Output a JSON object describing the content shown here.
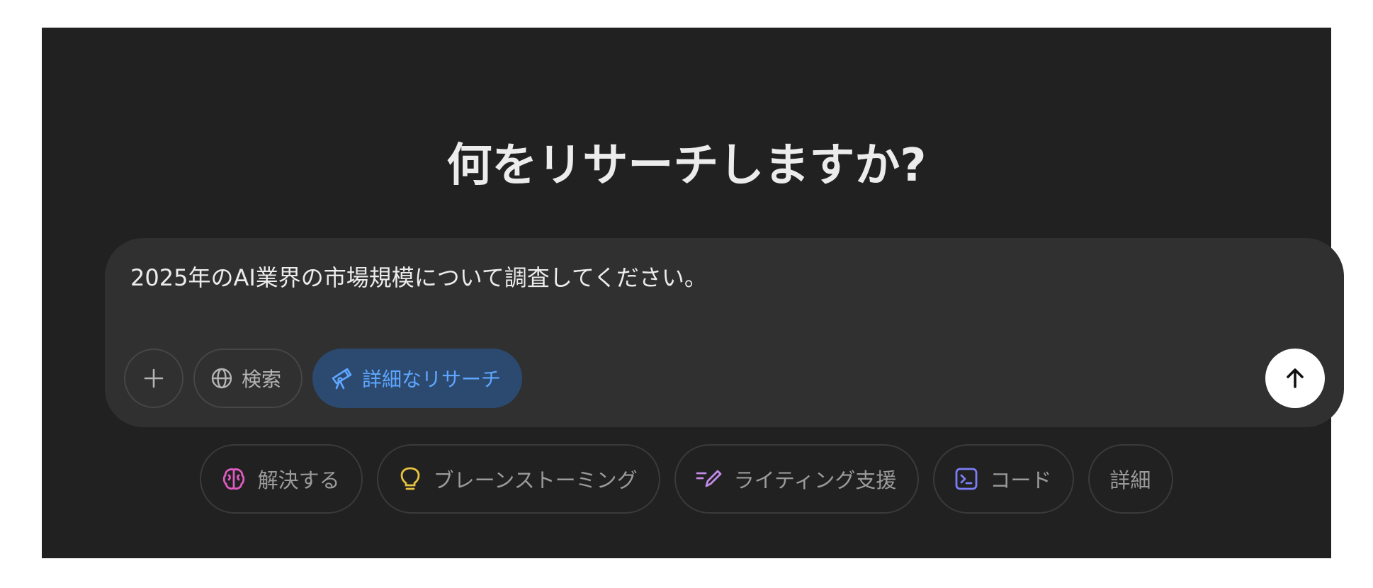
{
  "heading": "何をリサーチしますか?",
  "composer": {
    "prompt_text": "2025年のAI業界の市場規模について調査してください。",
    "tools": {
      "add_icon": "plus-icon",
      "search": {
        "label": "検索",
        "icon": "globe-icon"
      },
      "deep_research": {
        "label": "詳細なリサーチ",
        "icon": "telescope-icon",
        "active": true,
        "color": "#5ea6ff"
      }
    },
    "send_icon": "arrow-up-icon"
  },
  "suggestions": [
    {
      "label": "解決する",
      "icon": "brain-icon",
      "color": "#e05bc0"
    },
    {
      "label": "ブレーンストーミング",
      "icon": "lightbulb-icon",
      "color": "#e8c341"
    },
    {
      "label": "ライティング支援",
      "icon": "pen-icon",
      "color": "#c08ae6"
    },
    {
      "label": "コード",
      "icon": "terminal-icon",
      "color": "#7b7ef5"
    },
    {
      "label": "詳細",
      "icon": null
    }
  ]
}
